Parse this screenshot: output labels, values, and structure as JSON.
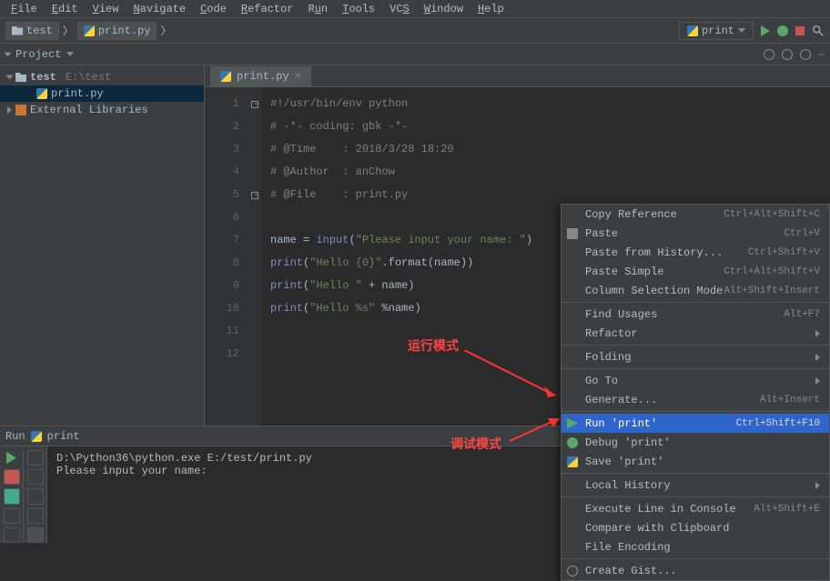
{
  "menubar": [
    "File",
    "Edit",
    "View",
    "Navigate",
    "Code",
    "Refactor",
    "Run",
    "Tools",
    "VCS",
    "Window",
    "Help"
  ],
  "breadcrumb": {
    "folder": "test",
    "file": "print.py"
  },
  "run_config": "print",
  "project_panel": {
    "title": "Project",
    "root": "test",
    "root_path": "E:\\test",
    "file": "print.py",
    "external": "External Libraries"
  },
  "tab": {
    "name": "print.py"
  },
  "code": {
    "l1": "#!/usr/bin/env python",
    "l2": "# -*- coding: gbk -*-",
    "l3": "# @Time    : 2018/3/28 18:20",
    "l4": "# @Author  : anChow",
    "l5": "# @File    : print.py",
    "l7_pre": "name = ",
    "l7_func": "input",
    "l7_str": "\"Please input your name: \"",
    "l8_func": "print",
    "l8_str": "\"Hello {0}\"",
    "l8_post": ".format(name))",
    "l9_func": "print",
    "l9_str": "\"Hello \"",
    "l9_post": " + name)",
    "l10_func": "print",
    "l10_str": "\"Hello %s\"",
    "l10_post": " %name)"
  },
  "run_panel": {
    "label": "Run",
    "target": "print"
  },
  "console": {
    "cmd": "D:\\Python36\\python.exe E:/test/print.py",
    "prompt": "Please input your name:"
  },
  "context_menu": {
    "copy_ref": "Copy Reference",
    "copy_ref_sc": "Ctrl+Alt+Shift+C",
    "paste": "Paste",
    "paste_sc": "Ctrl+V",
    "paste_hist": "Paste from History...",
    "paste_hist_sc": "Ctrl+Shift+V",
    "paste_simple": "Paste Simple",
    "paste_simple_sc": "Ctrl+Alt+Shift+V",
    "col_sel": "Column Selection Mode",
    "col_sel_sc": "Alt+Shift+Insert",
    "find_usages": "Find Usages",
    "find_usages_sc": "Alt+F7",
    "refactor": "Refactor",
    "folding": "Folding",
    "goto": "Go To",
    "generate": "Generate...",
    "generate_sc": "Alt+Insert",
    "run": "Run 'print'",
    "run_sc": "Ctrl+Shift+F10",
    "debug": "Debug 'print'",
    "save": "Save 'print'",
    "local_hist": "Local History",
    "exec_line": "Execute Line in Console",
    "exec_line_sc": "Alt+Shift+E",
    "compare": "Compare with Clipboard",
    "file_enc": "File Encoding",
    "gist": "Create Gist..."
  },
  "annotations": {
    "run_mode": "运行模式",
    "debug_mode": "调试模式"
  }
}
